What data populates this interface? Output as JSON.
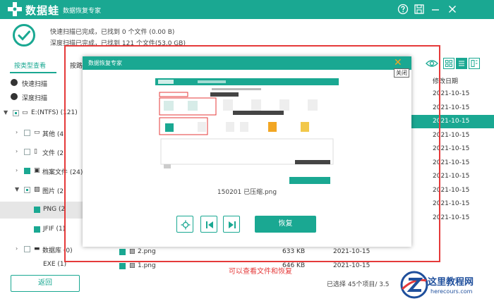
{
  "app": {
    "brand": "数据蛙",
    "subtitle": "数据恢复专家"
  },
  "titlebar_icons": [
    "help-icon",
    "save-icon",
    "minimize-icon",
    "close-icon"
  ],
  "status": {
    "line1": "快速扫描已完成，已找到 0 个文件 (0.00  B)",
    "line2": "深度扫描已完成，已找到 121 个文件(53.0 GB)"
  },
  "tabs": {
    "by_type": "按类型查看",
    "by_path": "按路"
  },
  "sidebar": {
    "quick_scan": "快速扫描",
    "deep_scan": "深度扫描",
    "drive": "E:(NTFS) (121)",
    "other": "其他 (4",
    "file": "文件 (2",
    "archive": "档案文件 (24)",
    "images": "图片 (2",
    "png": "PNG (2",
    "jfif": "JFIF (1)",
    "database": "数据库 (0)",
    "exe": "EXE (1)"
  },
  "table": {
    "modified_header": "修改日期",
    "dates": [
      "2021-10-15",
      "2021-10-15",
      "2021-10-15",
      "2021-10-15",
      "2021-10-15",
      "2021-10-15",
      "2021-10-15",
      "2021-10-15",
      "2021-10-15",
      "2021-10-15"
    ],
    "rows": [
      {
        "name": "2.png",
        "size": "633 KB",
        "date": "2021-10-15"
      },
      {
        "name": "1.png",
        "size": "646 KB",
        "date": "2021-10-15"
      }
    ]
  },
  "bottom": {
    "back": "返回",
    "selected": "已选择 45个项目/ 3.5"
  },
  "dialog": {
    "title": "数据恢复专家",
    "close_tooltip": "关闭",
    "file_caption": "150201 已压缩.png",
    "restore": "恢复"
  },
  "annotation": {
    "caption": "可以查看文件和恢复"
  },
  "watermark": {
    "text": "这里教程网",
    "url": "herecours.com"
  },
  "colors": {
    "accent": "#1aa892",
    "annotation": "#e53a3a",
    "watermark": "#1f4f9c"
  }
}
